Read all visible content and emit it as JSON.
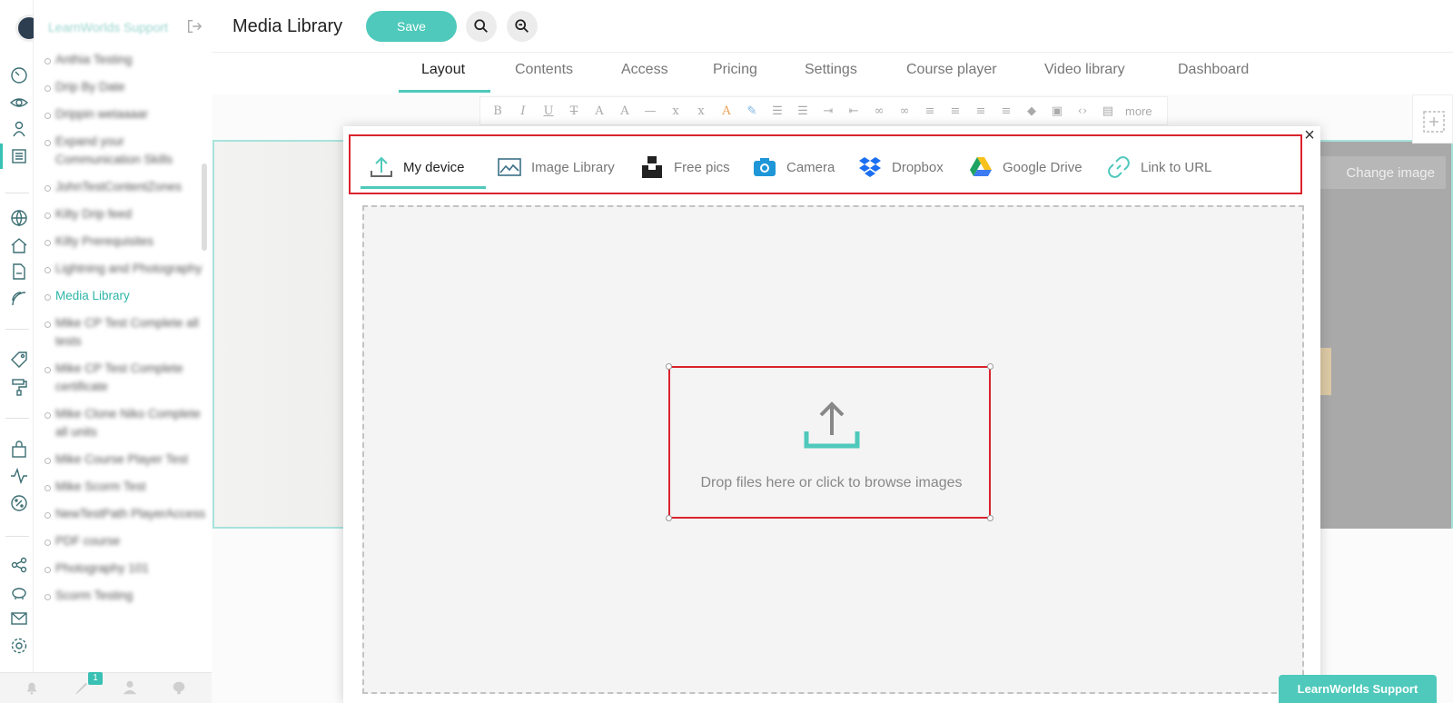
{
  "app": {
    "brand": "LearnWorlds Support",
    "page_title": "Media Library",
    "save_label": "Save"
  },
  "tabs": [
    {
      "label": "Layout",
      "active": true
    },
    {
      "label": "Contents"
    },
    {
      "label": "Access"
    },
    {
      "label": "Pricing"
    },
    {
      "label": "Settings"
    },
    {
      "label": "Course player"
    },
    {
      "label": "Video library"
    },
    {
      "label": "Dashboard"
    }
  ],
  "sidebar": {
    "courses": [
      {
        "label": "Anthia Testing"
      },
      {
        "label": "Drip By Date"
      },
      {
        "label": "Drippin wetaaaar"
      },
      {
        "label": "Expand your Communication Skills"
      },
      {
        "label": "JohnTestContentZones"
      },
      {
        "label": "Kilty Drip feed"
      },
      {
        "label": "Kilty Prerequisites"
      },
      {
        "label": "Lightning and Photography"
      },
      {
        "label": "Media Library",
        "active": true
      },
      {
        "label": "Mike CP Test Complete all tests"
      },
      {
        "label": "Mike CP Test Complete certificate"
      },
      {
        "label": "Mike Clone Niko Complete all units"
      },
      {
        "label": "Mike Course Player Test"
      },
      {
        "label": "Mike Scorm Test"
      },
      {
        "label": "NewTestPath PlayerAccess"
      },
      {
        "label": "PDF course"
      },
      {
        "label": "Photography 101"
      },
      {
        "label": "Scorm Testing"
      }
    ]
  },
  "bottom_bar": {
    "badge_count": "1"
  },
  "editor": {
    "more_label": "more",
    "change_image_label": "Change image"
  },
  "modal": {
    "close_glyph": "×",
    "sources": [
      {
        "label": "My device",
        "icon": "upload-icon",
        "active": true
      },
      {
        "label": "Image Library",
        "icon": "image-icon"
      },
      {
        "label": "Free pics",
        "icon": "unsplash-icon"
      },
      {
        "label": "Camera",
        "icon": "camera-icon"
      },
      {
        "label": "Dropbox",
        "icon": "dropbox-icon"
      },
      {
        "label": "Google Drive",
        "icon": "google-drive-icon"
      },
      {
        "label": "Link to URL",
        "icon": "link-icon"
      }
    ],
    "drop_text": "Drop files here or click to browse images"
  },
  "support_label": "LearnWorlds Support",
  "colors": {
    "accent": "#4ec9bb",
    "highlight_box": "#d9232d"
  }
}
